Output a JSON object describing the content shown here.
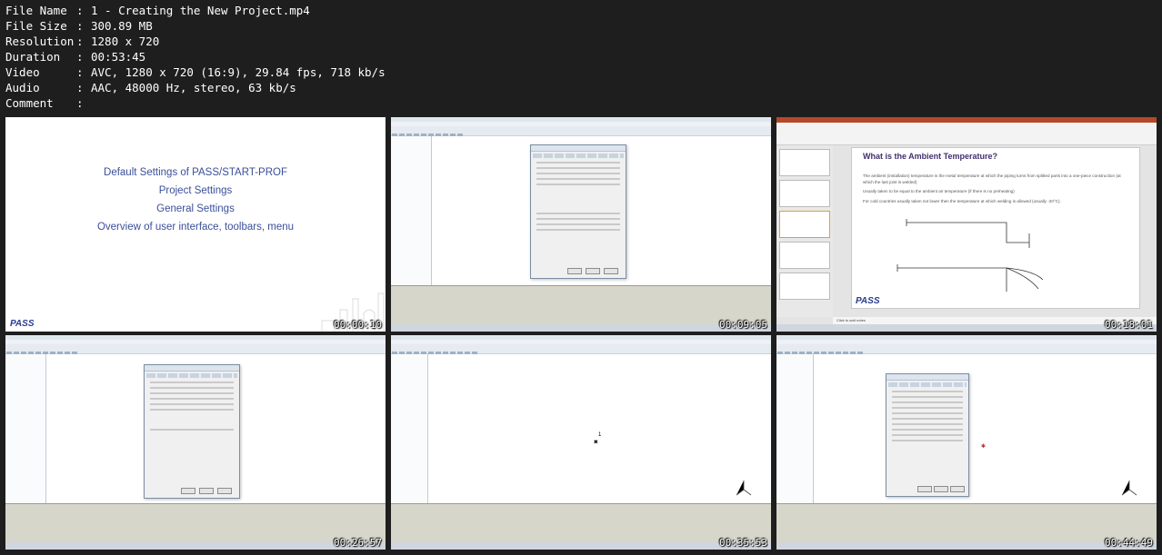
{
  "file_info": [
    {
      "key": "File Name",
      "value": "1 - Creating the New Project.mp4"
    },
    {
      "key": "File Size",
      "value": "300.89 MB"
    },
    {
      "key": "Resolution",
      "value": "1280 x 720"
    },
    {
      "key": "Duration",
      "value": "00:53:45"
    },
    {
      "key": "Video",
      "value": "AVC, 1280 x 720 (16:9), 29.84 fps, 718 kb/s"
    },
    {
      "key": "Audio",
      "value": "AAC, 48000 Hz, stereo, 63 kb/s"
    },
    {
      "key": "Comment",
      "value": ""
    }
  ],
  "separator": ":",
  "thumbnails": [
    {
      "timestamp": "00:00:10",
      "type": "slide",
      "slide_lines": [
        "Default Settings of PASS/START-PROF",
        "Project Settings",
        "General Settings",
        "Overview of user interface, toolbars, menu"
      ],
      "logo": "PASS"
    },
    {
      "timestamp": "00:09:05",
      "type": "app-dialog"
    },
    {
      "timestamp": "00:18:01",
      "type": "powerpoint",
      "slide_title": "What is the Ambient Temperature?",
      "slide_body": [
        "The ambient (installation) temperature is the metal temperature at which the piping turns from splitted parts into a one-piece construction (at which the last joint is welded)",
        "Usually taken to be equal to the ambient air temperature (if there is no preheating)",
        "For cold countries usually taken not lower then the temperature at which welding is allowed (usually -20°C)."
      ],
      "notes_placeholder": "Click to add notes",
      "logo": "PASS"
    },
    {
      "timestamp": "00:26:57",
      "type": "app-dialog"
    },
    {
      "timestamp": "00:35:53",
      "type": "app-model",
      "node_label": "1"
    },
    {
      "timestamp": "00:44:49",
      "type": "app-settings"
    }
  ],
  "colors": {
    "background": "#1e1e1e",
    "text": "#ffffff",
    "slide_text": "#3a4f9a",
    "message_pane": "#d6d6ca"
  }
}
